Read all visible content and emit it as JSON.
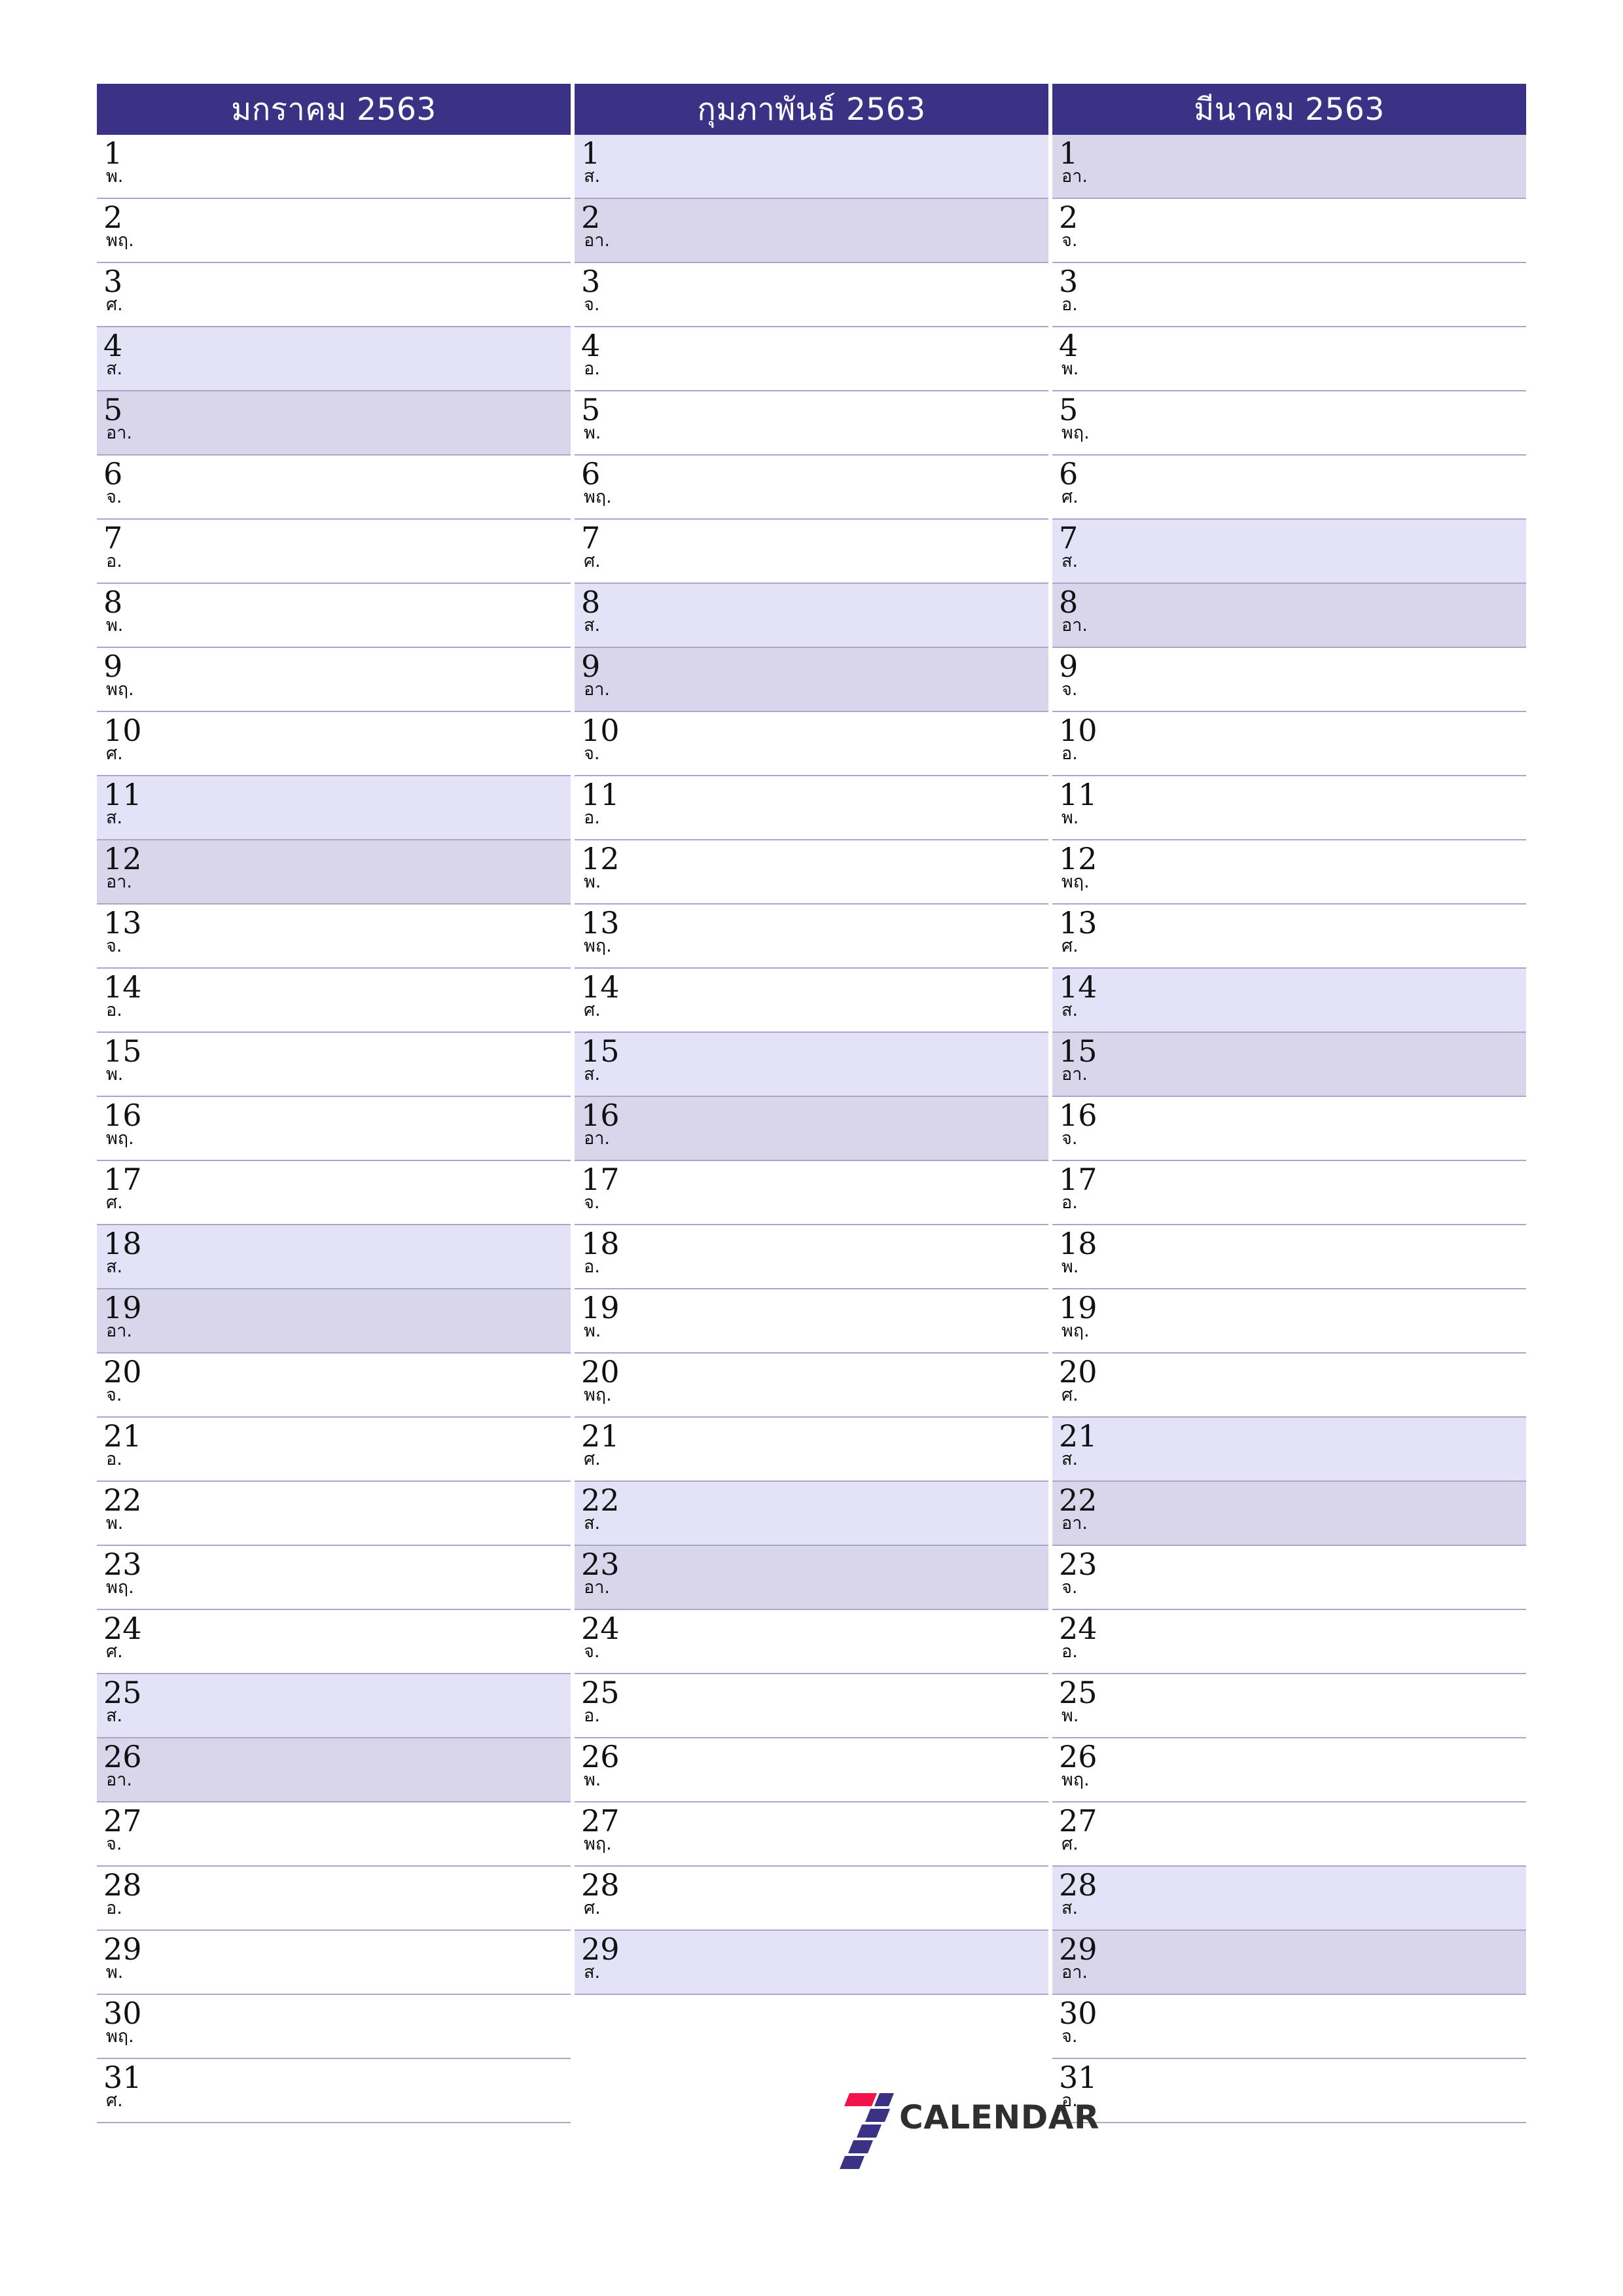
{
  "document": {
    "kind": "three-month-planner",
    "year_label": "2563"
  },
  "colors": {
    "header_background": "#3b3285",
    "header_text": "#ffffff",
    "saturday_background": "#e3e2f7",
    "sunday_background": "#d9d6ec",
    "row_separator": "#a9a7c9",
    "page_background": "#ffffff",
    "day_text": "#111111",
    "logo_red": "#f4124a",
    "logo_purple": "#3b3285",
    "logo_text": "#2f2f2f"
  },
  "weekday_abbreviations": {
    "sunday": "อา.",
    "monday": "จ.",
    "tuesday": "อ.",
    "wednesday": "พ.",
    "thursday": "พฤ.",
    "friday": "ศ.",
    "saturday": "ส."
  },
  "months": [
    {
      "title": "มกราคม 2563",
      "days": [
        {
          "num": "1",
          "abbr": "พ.",
          "type": "weekday"
        },
        {
          "num": "2",
          "abbr": "พฤ.",
          "type": "weekday"
        },
        {
          "num": "3",
          "abbr": "ศ.",
          "type": "weekday"
        },
        {
          "num": "4",
          "abbr": "ส.",
          "type": "sat"
        },
        {
          "num": "5",
          "abbr": "อา.",
          "type": "sun"
        },
        {
          "num": "6",
          "abbr": "จ.",
          "type": "weekday"
        },
        {
          "num": "7",
          "abbr": "อ.",
          "type": "weekday"
        },
        {
          "num": "8",
          "abbr": "พ.",
          "type": "weekday"
        },
        {
          "num": "9",
          "abbr": "พฤ.",
          "type": "weekday"
        },
        {
          "num": "10",
          "abbr": "ศ.",
          "type": "weekday"
        },
        {
          "num": "11",
          "abbr": "ส.",
          "type": "sat"
        },
        {
          "num": "12",
          "abbr": "อา.",
          "type": "sun"
        },
        {
          "num": "13",
          "abbr": "จ.",
          "type": "weekday"
        },
        {
          "num": "14",
          "abbr": "อ.",
          "type": "weekday"
        },
        {
          "num": "15",
          "abbr": "พ.",
          "type": "weekday"
        },
        {
          "num": "16",
          "abbr": "พฤ.",
          "type": "weekday"
        },
        {
          "num": "17",
          "abbr": "ศ.",
          "type": "weekday"
        },
        {
          "num": "18",
          "abbr": "ส.",
          "type": "sat"
        },
        {
          "num": "19",
          "abbr": "อา.",
          "type": "sun"
        },
        {
          "num": "20",
          "abbr": "จ.",
          "type": "weekday"
        },
        {
          "num": "21",
          "abbr": "อ.",
          "type": "weekday"
        },
        {
          "num": "22",
          "abbr": "พ.",
          "type": "weekday"
        },
        {
          "num": "23",
          "abbr": "พฤ.",
          "type": "weekday"
        },
        {
          "num": "24",
          "abbr": "ศ.",
          "type": "weekday"
        },
        {
          "num": "25",
          "abbr": "ส.",
          "type": "sat"
        },
        {
          "num": "26",
          "abbr": "อา.",
          "type": "sun"
        },
        {
          "num": "27",
          "abbr": "จ.",
          "type": "weekday"
        },
        {
          "num": "28",
          "abbr": "อ.",
          "type": "weekday"
        },
        {
          "num": "29",
          "abbr": "พ.",
          "type": "weekday"
        },
        {
          "num": "30",
          "abbr": "พฤ.",
          "type": "weekday"
        },
        {
          "num": "31",
          "abbr": "ศ.",
          "type": "weekday"
        }
      ]
    },
    {
      "title": "กุมภาพันธ์ 2563",
      "days": [
        {
          "num": "1",
          "abbr": "ส.",
          "type": "sat"
        },
        {
          "num": "2",
          "abbr": "อา.",
          "type": "sun"
        },
        {
          "num": "3",
          "abbr": "จ.",
          "type": "weekday"
        },
        {
          "num": "4",
          "abbr": "อ.",
          "type": "weekday"
        },
        {
          "num": "5",
          "abbr": "พ.",
          "type": "weekday"
        },
        {
          "num": "6",
          "abbr": "พฤ.",
          "type": "weekday"
        },
        {
          "num": "7",
          "abbr": "ศ.",
          "type": "weekday"
        },
        {
          "num": "8",
          "abbr": "ส.",
          "type": "sat"
        },
        {
          "num": "9",
          "abbr": "อา.",
          "type": "sun"
        },
        {
          "num": "10",
          "abbr": "จ.",
          "type": "weekday"
        },
        {
          "num": "11",
          "abbr": "อ.",
          "type": "weekday"
        },
        {
          "num": "12",
          "abbr": "พ.",
          "type": "weekday"
        },
        {
          "num": "13",
          "abbr": "พฤ.",
          "type": "weekday"
        },
        {
          "num": "14",
          "abbr": "ศ.",
          "type": "weekday"
        },
        {
          "num": "15",
          "abbr": "ส.",
          "type": "sat"
        },
        {
          "num": "16",
          "abbr": "อา.",
          "type": "sun"
        },
        {
          "num": "17",
          "abbr": "จ.",
          "type": "weekday"
        },
        {
          "num": "18",
          "abbr": "อ.",
          "type": "weekday"
        },
        {
          "num": "19",
          "abbr": "พ.",
          "type": "weekday"
        },
        {
          "num": "20",
          "abbr": "พฤ.",
          "type": "weekday"
        },
        {
          "num": "21",
          "abbr": "ศ.",
          "type": "weekday"
        },
        {
          "num": "22",
          "abbr": "ส.",
          "type": "sat"
        },
        {
          "num": "23",
          "abbr": "อา.",
          "type": "sun"
        },
        {
          "num": "24",
          "abbr": "จ.",
          "type": "weekday"
        },
        {
          "num": "25",
          "abbr": "อ.",
          "type": "weekday"
        },
        {
          "num": "26",
          "abbr": "พ.",
          "type": "weekday"
        },
        {
          "num": "27",
          "abbr": "พฤ.",
          "type": "weekday"
        },
        {
          "num": "28",
          "abbr": "ศ.",
          "type": "weekday"
        },
        {
          "num": "29",
          "abbr": "ส.",
          "type": "sat"
        }
      ]
    },
    {
      "title": "มีนาคม 2563",
      "days": [
        {
          "num": "1",
          "abbr": "อา.",
          "type": "sun"
        },
        {
          "num": "2",
          "abbr": "จ.",
          "type": "weekday"
        },
        {
          "num": "3",
          "abbr": "อ.",
          "type": "weekday"
        },
        {
          "num": "4",
          "abbr": "พ.",
          "type": "weekday"
        },
        {
          "num": "5",
          "abbr": "พฤ.",
          "type": "weekday"
        },
        {
          "num": "6",
          "abbr": "ศ.",
          "type": "weekday"
        },
        {
          "num": "7",
          "abbr": "ส.",
          "type": "sat"
        },
        {
          "num": "8",
          "abbr": "อา.",
          "type": "sun"
        },
        {
          "num": "9",
          "abbr": "จ.",
          "type": "weekday"
        },
        {
          "num": "10",
          "abbr": "อ.",
          "type": "weekday"
        },
        {
          "num": "11",
          "abbr": "พ.",
          "type": "weekday"
        },
        {
          "num": "12",
          "abbr": "พฤ.",
          "type": "weekday"
        },
        {
          "num": "13",
          "abbr": "ศ.",
          "type": "weekday"
        },
        {
          "num": "14",
          "abbr": "ส.",
          "type": "sat"
        },
        {
          "num": "15",
          "abbr": "อา.",
          "type": "sun"
        },
        {
          "num": "16",
          "abbr": "จ.",
          "type": "weekday"
        },
        {
          "num": "17",
          "abbr": "อ.",
          "type": "weekday"
        },
        {
          "num": "18",
          "abbr": "พ.",
          "type": "weekday"
        },
        {
          "num": "19",
          "abbr": "พฤ.",
          "type": "weekday"
        },
        {
          "num": "20",
          "abbr": "ศ.",
          "type": "weekday"
        },
        {
          "num": "21",
          "abbr": "ส.",
          "type": "sat"
        },
        {
          "num": "22",
          "abbr": "อา.",
          "type": "sun"
        },
        {
          "num": "23",
          "abbr": "จ.",
          "type": "weekday"
        },
        {
          "num": "24",
          "abbr": "อ.",
          "type": "weekday"
        },
        {
          "num": "25",
          "abbr": "พ.",
          "type": "weekday"
        },
        {
          "num": "26",
          "abbr": "พฤ.",
          "type": "weekday"
        },
        {
          "num": "27",
          "abbr": "ศ.",
          "type": "weekday"
        },
        {
          "num": "28",
          "abbr": "ส.",
          "type": "sat"
        },
        {
          "num": "29",
          "abbr": "อา.",
          "type": "sun"
        },
        {
          "num": "30",
          "abbr": "จ.",
          "type": "weekday"
        },
        {
          "num": "31",
          "abbr": "อ.",
          "type": "weekday"
        }
      ]
    }
  ],
  "logo": {
    "mark": "seven-stripes-mark",
    "text": "CALENDAR"
  }
}
